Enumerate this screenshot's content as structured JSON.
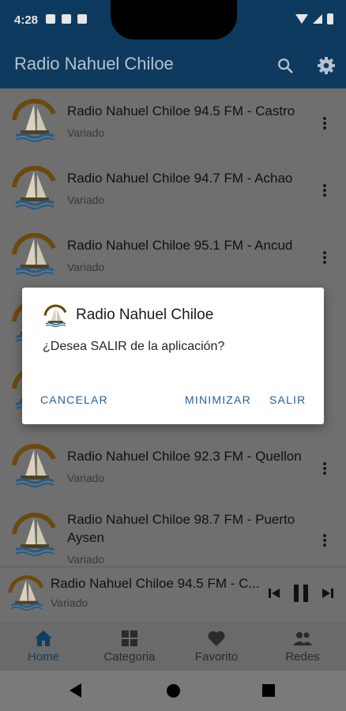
{
  "status_bar": {
    "time": "4:28"
  },
  "app_bar": {
    "title": "Radio Nahuel Chiloe"
  },
  "stations": [
    {
      "title": "Radio Nahuel Chiloe 94.5 FM - Castro",
      "genre": "Variado"
    },
    {
      "title": "Radio Nahuel Chiloe 94.7 FM - Achao",
      "genre": "Variado"
    },
    {
      "title": "Radio Nahuel Chiloe 95.1 FM - Ancud",
      "genre": "Variado"
    },
    {
      "title": "Radio Nahuel Chiloe 92.3 FM - Quellon",
      "genre": "Variado"
    },
    {
      "title_line1": "Radio Nahuel Chiloe 98.7 FM - Puerto",
      "title_line2": "Aysen",
      "genre": "Variado"
    }
  ],
  "mini_player": {
    "title": "Radio Nahuel Chiloe 94.5 FM - C...",
    "subtitle": "Variado"
  },
  "bottom_nav": {
    "items": [
      {
        "label": "Home",
        "icon": "home-icon",
        "active": true
      },
      {
        "label": "Categoria",
        "icon": "grid-icon",
        "active": false
      },
      {
        "label": "Favorito",
        "icon": "heart-icon",
        "active": false
      },
      {
        "label": "Redes",
        "icon": "people-icon",
        "active": false
      }
    ]
  },
  "dialog": {
    "title": "Radio Nahuel Chiloe",
    "message": "¿Desea SALIR de la aplicación?",
    "cancel_label": "CANCELAR",
    "minimize_label": "MINIMIZAR",
    "exit_label": "SALIR"
  },
  "colors": {
    "primary": "#0e3e63",
    "accent_button": "#2a5e9a",
    "scrim": "#6f6f6f"
  }
}
